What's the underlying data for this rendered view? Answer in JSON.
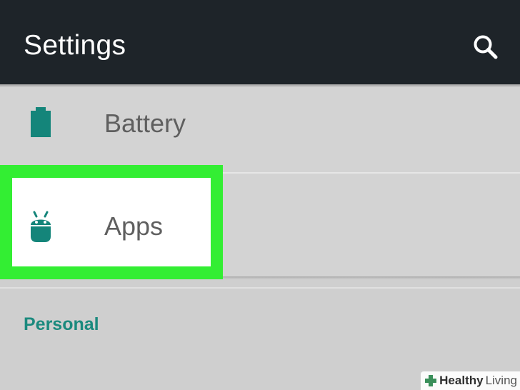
{
  "header": {
    "title": "Settings",
    "search_icon": "search-icon",
    "background": "#1e2429"
  },
  "items": [
    {
      "label": "Battery",
      "icon": "battery-icon"
    },
    {
      "label": "Apps",
      "icon": "android-icon",
      "highlighted": true
    }
  ],
  "sections": [
    {
      "header": "Personal"
    }
  ],
  "colors": {
    "accent": "#1b8a7e",
    "highlight": "#33ee33"
  },
  "watermark": {
    "bold": "Healthy",
    "normal": "Living"
  }
}
